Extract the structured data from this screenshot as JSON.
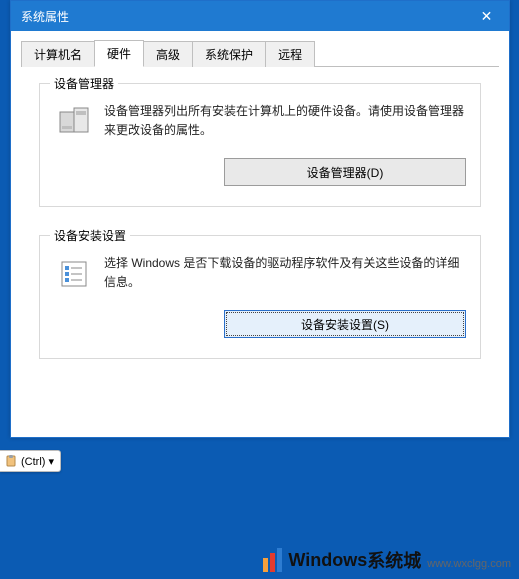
{
  "titlebar": {
    "title": "系统属性",
    "close_label": "✕"
  },
  "tabs": {
    "computer_name": "计算机名",
    "hardware": "硬件",
    "advanced": "高级",
    "system_protection": "系统保护",
    "remote": "远程"
  },
  "device_manager_group": {
    "title": "设备管理器",
    "desc": "设备管理器列出所有安装在计算机上的硬件设备。请使用设备管理器来更改设备的属性。",
    "button": "设备管理器(D)"
  },
  "install_settings_group": {
    "title": "设备安装设置",
    "desc": "选择 Windows 是否下载设备的驱动程序软件及有关这些设备的详细信息。",
    "button": "设备安装设置(S)"
  },
  "paste_tag": {
    "label": "(Ctrl) ▾"
  },
  "watermark": {
    "brand1": "Windows",
    "brand2": "系统城",
    "url": "www.wxclgg.com"
  }
}
